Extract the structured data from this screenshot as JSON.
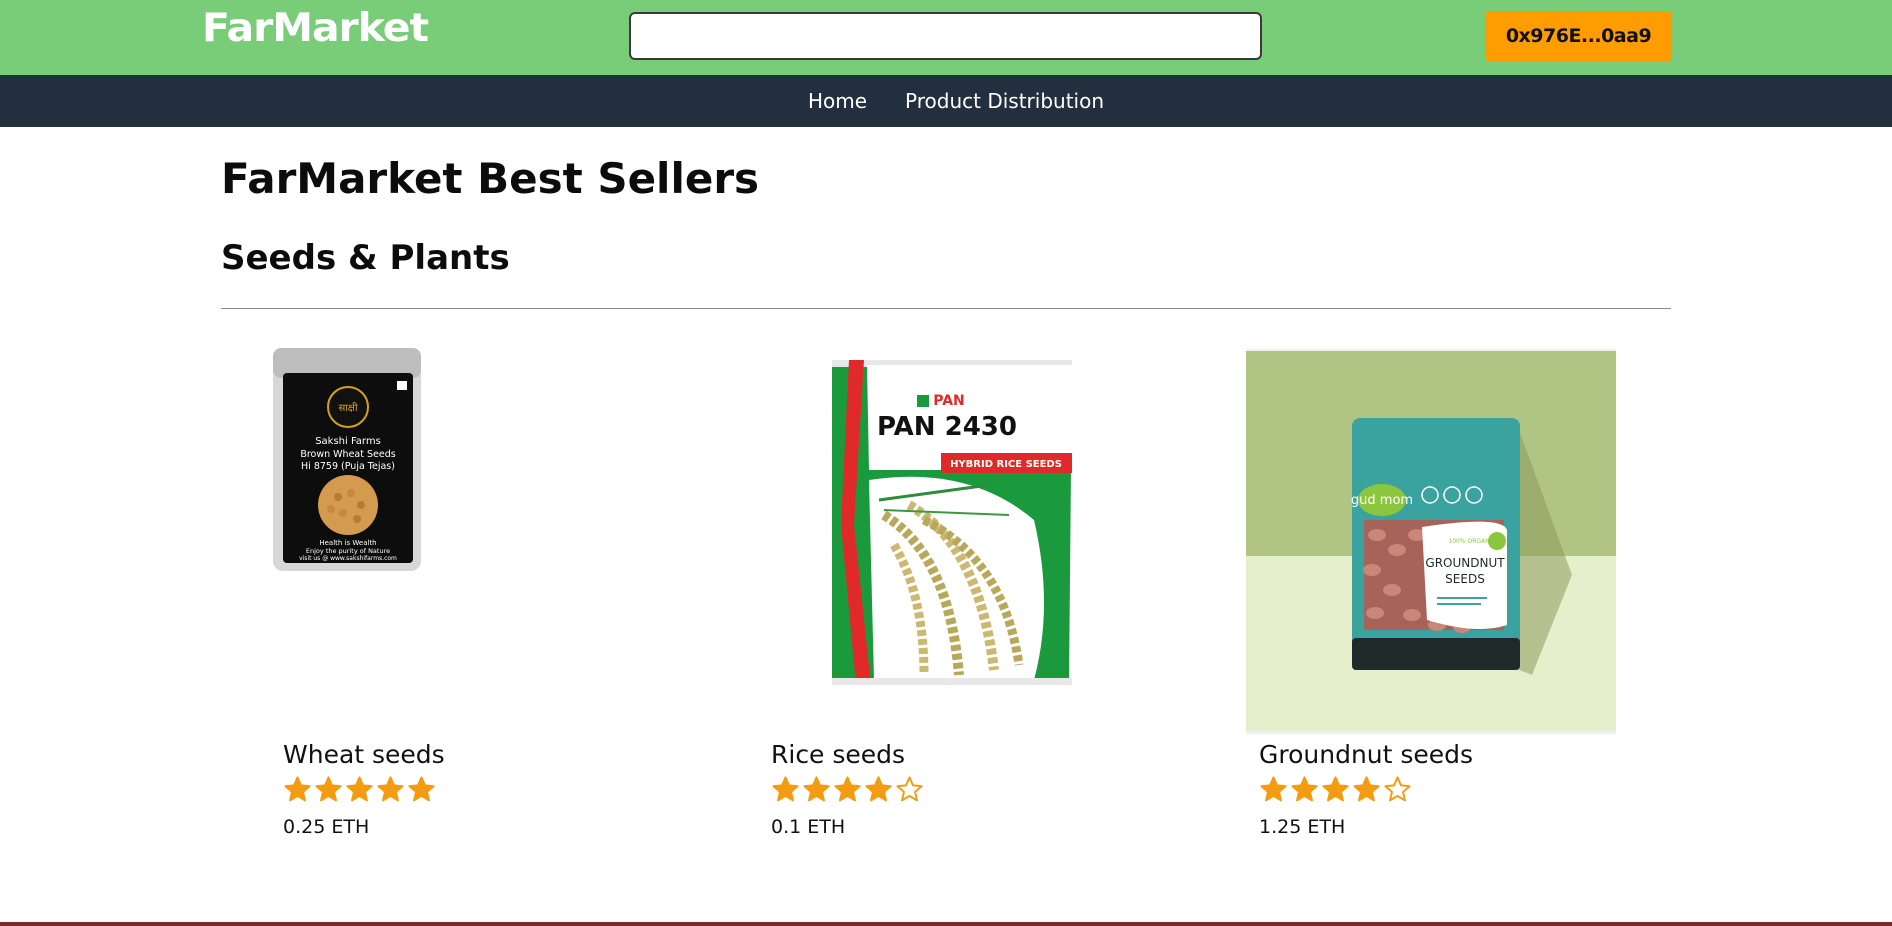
{
  "header": {
    "logo": "FarMarket",
    "search_placeholder": "",
    "wallet_label": "0x976E...0aa9"
  },
  "nav": {
    "items": [
      {
        "label": "Home"
      },
      {
        "label": "Product Distribution"
      }
    ]
  },
  "main": {
    "title": "FarMarket Best Sellers",
    "section_title": "Seeds & Plants"
  },
  "products": [
    {
      "name": "Wheat seeds",
      "rating": 5,
      "max_rating": 5,
      "price": "0.25 ETH",
      "package": {
        "brand": "Sakshi Farms",
        "line1": "Brown Wheat Seeds",
        "line2": "Hi 8759 (Puja Tejas)",
        "foot1": "Health is Wealth",
        "foot2": "Enjoy the purity of Nature",
        "foot3": "visit us @ www.sakshifarms.com"
      }
    },
    {
      "name": "Rice seeds",
      "rating": 4,
      "max_rating": 5,
      "price": "0.1 ETH",
      "package": {
        "brand": "PAN",
        "model": "PAN 2430",
        "tag": "HYBRID RICE SEEDS"
      }
    },
    {
      "name": "Groundnut seeds",
      "rating": 4,
      "max_rating": 5,
      "price": "1.25 ETH",
      "package": {
        "brand": "gud mom",
        "badge": "100% ORGANIC",
        "title1": "GROUNDNUT",
        "title2": "SEEDS"
      }
    }
  ],
  "colors": {
    "header_bg": "#79cc78",
    "nav_bg": "#232f3e",
    "wallet_bg": "#ff9c00",
    "star": "#f39c12"
  }
}
